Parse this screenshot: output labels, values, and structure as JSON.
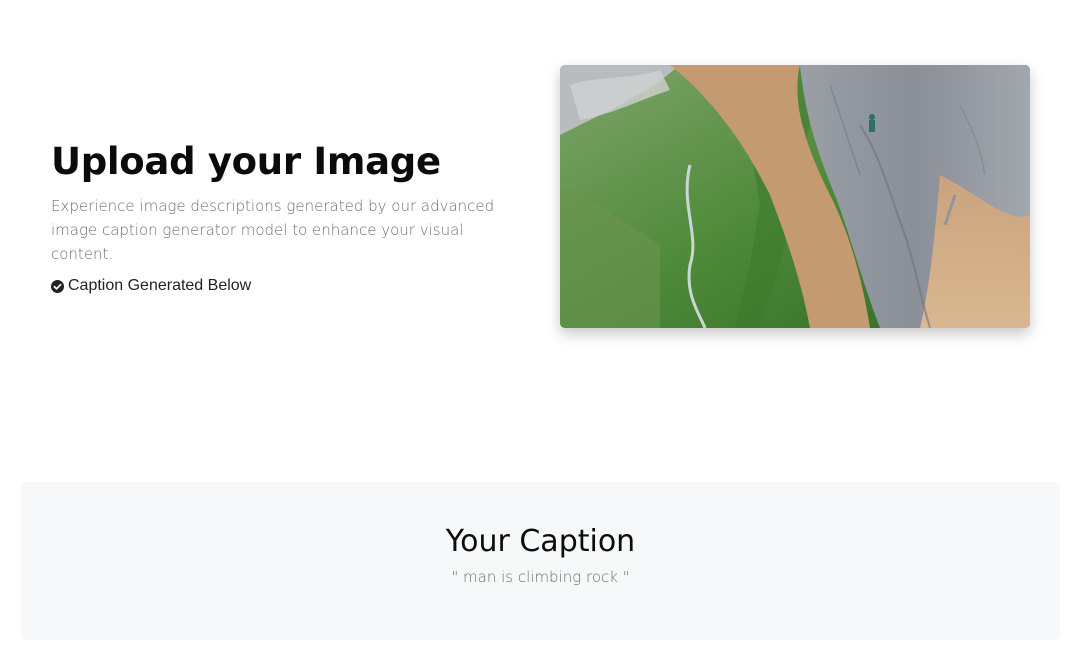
{
  "hero": {
    "title": "Upload your Image",
    "description": "Experience image descriptions generated by our advanced image caption generator model to enhance your visual content.",
    "status_label": "Caption Generated Below",
    "status_icon": "check-circle-icon",
    "image_alt": "uploaded-photo"
  },
  "caption_section": {
    "heading": "Your Caption",
    "caption": "\" man is climbing rock \""
  },
  "colors": {
    "background": "#ffffff",
    "panel": "#f7f8fa",
    "title": "#0b0b0b",
    "muted_text": "#6b6f75"
  }
}
